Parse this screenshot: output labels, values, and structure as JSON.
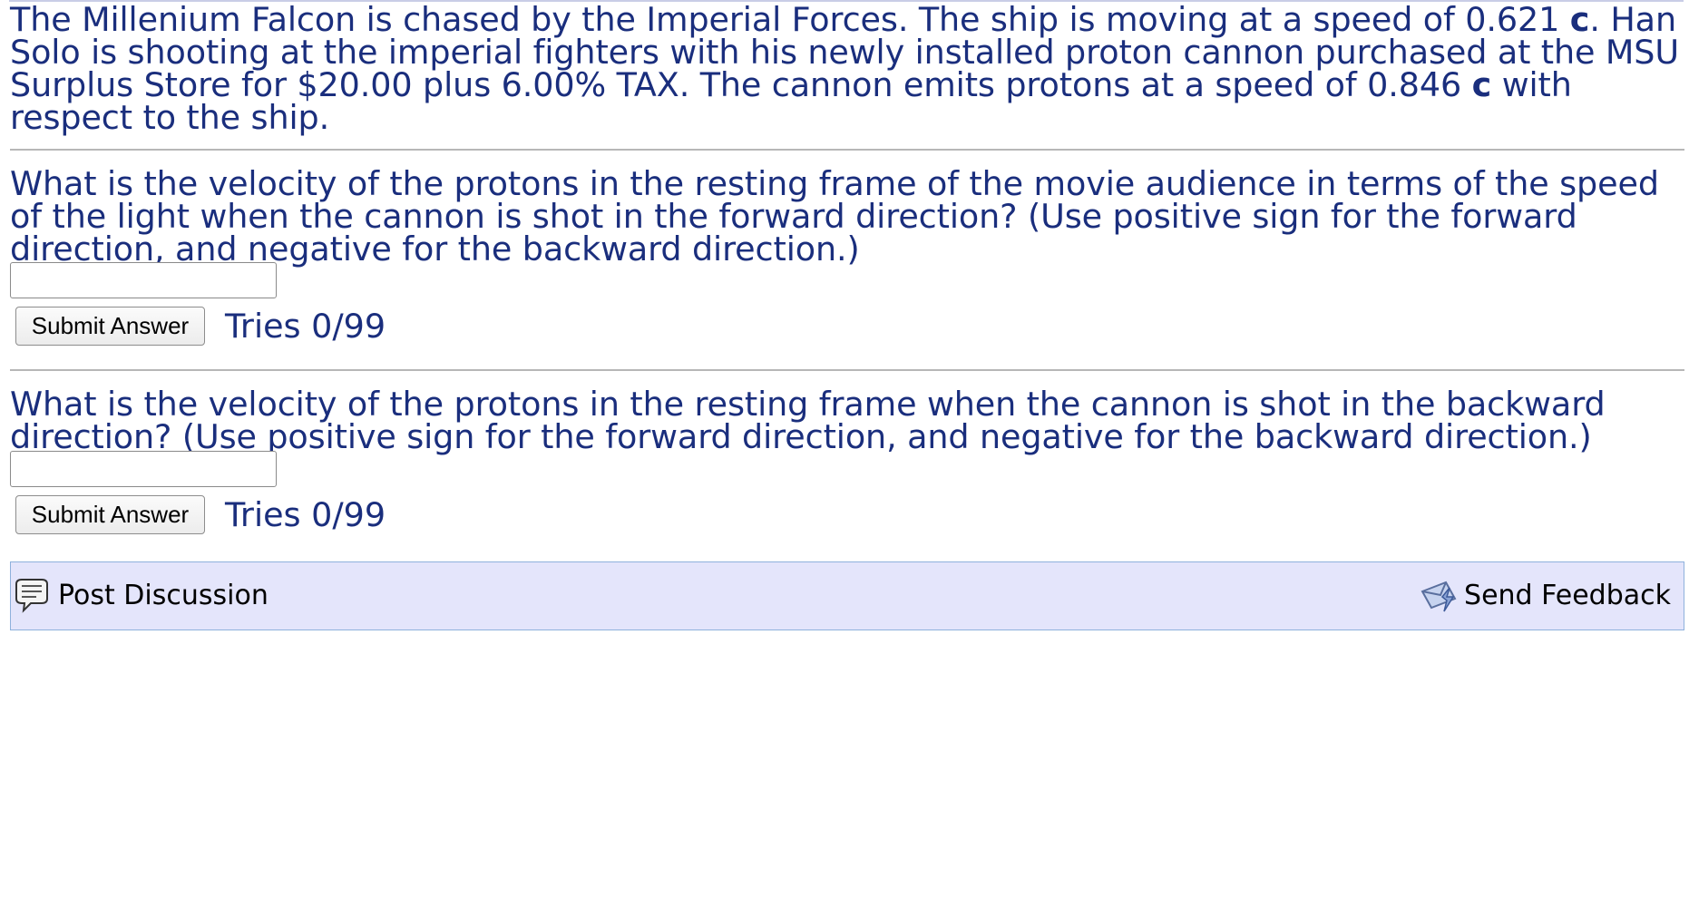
{
  "problem": {
    "text_1": "The Millenium Falcon is chased by the Imperial Forces. The ship is moving at a speed of 0.621 ",
    "c_1": "c",
    "text_2": ". Han Solo is shooting at the imperial fighters with his newly installed proton cannon purchased at the MSU Surplus Store for $20.00 plus 6.00% TAX. The cannon emits protons at a speed of 0.846 ",
    "c_2": "c",
    "text_3": " with respect to the ship."
  },
  "questions": [
    {
      "text": "What is the velocity of the protons in the resting frame of the movie audience in terms of the speed of the light when the cannon is shot in the forward direction? (Use positive sign for the forward direction, and negative for the backward direction.)",
      "input_value": "",
      "submit_label": "Submit Answer",
      "tries": "Tries 0/99"
    },
    {
      "text": "What is the velocity of the protons in the resting frame when the cannon is shot in the backward direction? (Use positive sign for the forward direction, and negative for the backward direction.)",
      "input_value": "",
      "submit_label": "Submit Answer",
      "tries": "Tries 0/99"
    }
  ],
  "footer": {
    "post_discussion": "Post Discussion",
    "send_feedback": "Send Feedback",
    "post_icon": "discussion-bubble-icon",
    "feedback_icon": "feedback-envelope-icon"
  },
  "colors": {
    "text": "#1a2e7d",
    "footer_background": "#e4e5fb",
    "footer_border": "#8eb1dc"
  }
}
